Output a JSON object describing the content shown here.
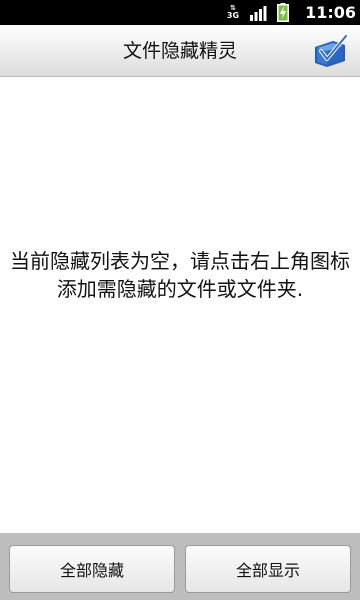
{
  "status_bar": {
    "network_type": "3G",
    "time": "11:06",
    "icons": [
      "data-activity-icon",
      "signal-icon",
      "battery-charging-icon"
    ]
  },
  "title_bar": {
    "title": "文件隐藏精灵",
    "action_icon": "add-folder-check-icon"
  },
  "main": {
    "empty_message": "当前隐藏列表为空，请点击右上角图标添加需隐藏的文件或文件夹."
  },
  "bottom_bar": {
    "hide_all_label": "全部隐藏",
    "show_all_label": "全部显示"
  },
  "colors": {
    "status_bar": "#000000",
    "battery_green": "#7ac142",
    "accent_blue": "#2f6fc8"
  }
}
